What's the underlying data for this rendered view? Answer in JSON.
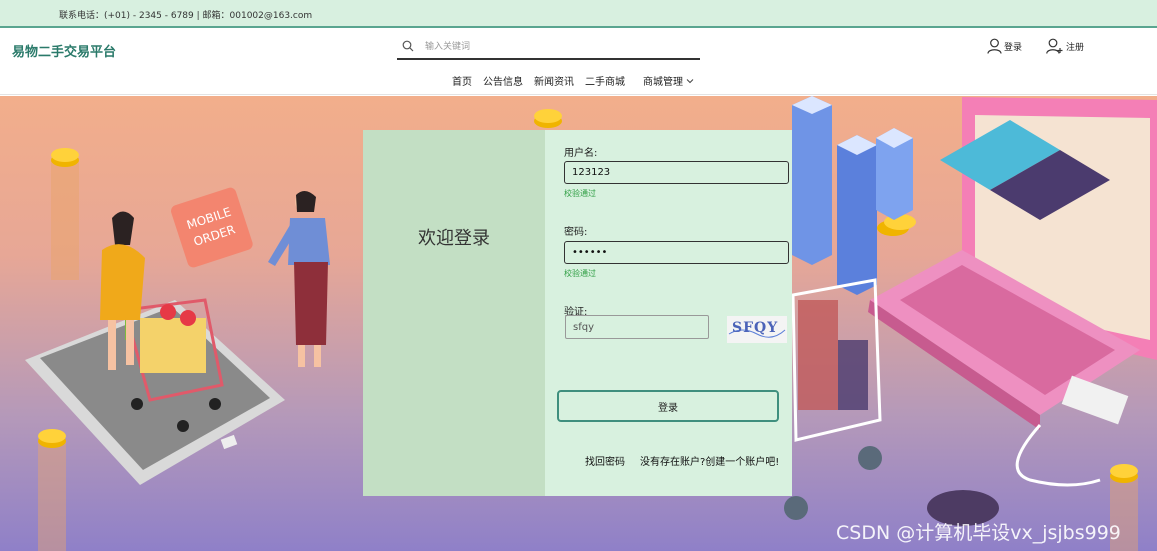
{
  "topbar": {
    "contact": "联系电话：(+01) - 2345 - 6789 | 邮箱：001002@163.com"
  },
  "header": {
    "brand": "易物二手交易平台",
    "search_placeholder": "输入关键词",
    "login_label": "登录",
    "register_label": "注册"
  },
  "nav": {
    "items": [
      "首页",
      "公告信息",
      "新闻资讯",
      "二手商城",
      "商城管理"
    ]
  },
  "hero_art": {
    "sign_text_1": "MOBILE",
    "sign_text_2": "ORDER"
  },
  "login_form": {
    "welcome": "欢迎登录",
    "username_label": "用户名:",
    "username_value": "123123",
    "username_hint": "校验通过",
    "password_label": "密码:",
    "password_value": "••••••",
    "password_hint": "校验通过",
    "captcha_label": "验证:",
    "captcha_value": "sfqy",
    "captcha_image_text": "SFQY",
    "submit_label": "登录",
    "forgot_label": "找回密码",
    "register_link": "没有存在账户?创建一个账户吧!"
  },
  "watermark": "CSDN @计算机毕设vx_jsjbs999",
  "colors": {
    "accent": "#2a7a6a",
    "card_left": "#c3dfc4",
    "card_right": "#d8f1df",
    "topbar": "#d8f0e0",
    "hint": "#2f9e44"
  }
}
